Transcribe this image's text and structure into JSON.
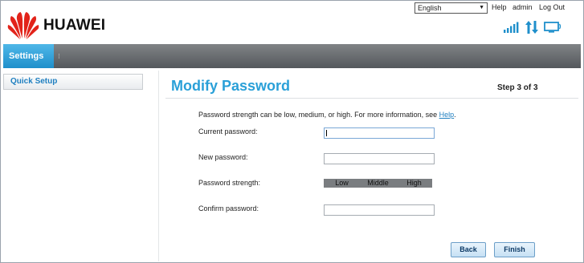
{
  "brand": {
    "name": "HUAWEI",
    "logo_icon": "huawei-petal-logo-icon",
    "logo_color": "#e2231a"
  },
  "top_bar": {
    "language": {
      "selected": "English",
      "arrow": "▼"
    },
    "help": "Help",
    "user": "admin",
    "logout": "Log Out"
  },
  "status_icons": [
    "signal-strength-icon",
    "data-transfer-icon",
    "computer-connection-icon"
  ],
  "nav": {
    "tabs": [
      {
        "label": "Settings",
        "active": true
      }
    ],
    "separator": "⁝"
  },
  "sidebar": {
    "items": [
      {
        "label": "Quick Setup",
        "active": true
      }
    ]
  },
  "main": {
    "title": "Modify Password",
    "step": "Step 3 of 3",
    "info_text": "Password strength can be low, medium, or high. For more information, see ",
    "info_link": "Help",
    "info_end": ".",
    "fields": {
      "current_password": {
        "label": "Current password:",
        "value": ""
      },
      "new_password": {
        "label": "New password:",
        "value": ""
      },
      "strength": {
        "label": "Password strength:",
        "levels": [
          "Low",
          "Middle",
          "High"
        ]
      },
      "confirm_password": {
        "label": "Confirm password:",
        "value": ""
      }
    },
    "buttons": {
      "back": "Back",
      "finish": "Finish"
    }
  },
  "colors": {
    "accent": "#2aa0d8",
    "nav_active": "#1f8fcb",
    "nav_bar": "#5e6266",
    "link": "#1f7fc0"
  }
}
